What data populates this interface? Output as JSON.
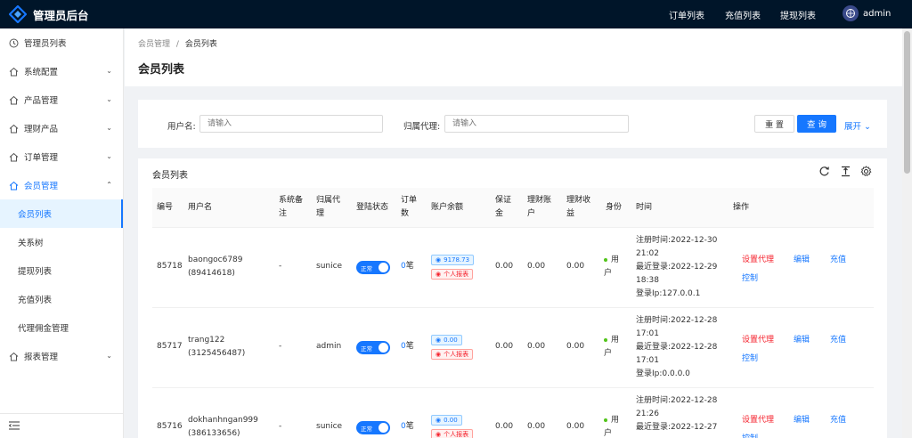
{
  "app": {
    "title": "管理员后台"
  },
  "header": {
    "nav": [
      "订单列表",
      "充值列表",
      "提现列表"
    ],
    "user": "admin"
  },
  "sidebar": {
    "items": [
      {
        "label": "管理员列表"
      },
      {
        "label": "系统配置"
      },
      {
        "label": "产品管理"
      },
      {
        "label": "理财产品"
      },
      {
        "label": "订单管理"
      },
      {
        "label": "会员管理"
      },
      {
        "label": "报表管理"
      }
    ],
    "subitems": [
      "会员列表",
      "关系树",
      "提现列表",
      "充值列表",
      "代理佣金管理"
    ],
    "active": "会员列表"
  },
  "breadcrumb": [
    "会员管理",
    "/",
    "会员列表"
  ],
  "page_title": "会员列表",
  "filter": {
    "username_label": "用户名:",
    "username_placeholder": "请输入",
    "agent_label": "归属代理:",
    "agent_placeholder": "请输入",
    "reset": "重 置",
    "query": "查 询",
    "expand": "展开"
  },
  "table": {
    "caption": "会员列表",
    "headers": [
      "编号",
      "用户名",
      "系统备注",
      "归属代理",
      "登陆状态",
      "订单数",
      "账户余额",
      "保证金",
      "理财账户",
      "理财收益",
      "身份",
      "时间",
      "操作"
    ],
    "rows": [
      {
        "id": "85718",
        "username": "baongoc6789",
        "phone": "(89414618)",
        "remark": "-",
        "agent": "sunice",
        "status": "正常",
        "orders": "0",
        "orders_unit": "笔",
        "balance": "9178.73",
        "report": "个人报表",
        "deposit": "0.00",
        "fin_account": "0.00",
        "fin_income": "0.00",
        "identity": "用户",
        "reg": "注册时间:2022-12-30 21:02",
        "last": "最近登录:2022-12-29 18:38",
        "ip": "登录Ip:127.0.0.1",
        "actions": [
          "设置代理",
          "编辑",
          "充值",
          "控制"
        ]
      },
      {
        "id": "85717",
        "username": "trang122",
        "phone": "(3125456487)",
        "remark": "-",
        "agent": "admin",
        "status": "正常",
        "orders": "0",
        "orders_unit": "笔",
        "balance": "0.00",
        "report": "个人报表",
        "deposit": "0.00",
        "fin_account": "0.00",
        "fin_income": "0.00",
        "identity": "用户",
        "reg": "注册时间:2022-12-28 17:01",
        "last": "最近登录:2022-12-28 17:01",
        "ip": "登录Ip:0.0.0.0",
        "actions": [
          "设置代理",
          "编辑",
          "充值",
          "控制"
        ]
      },
      {
        "id": "85716",
        "username": "dokhanhngan999",
        "phone": "(386133656)",
        "remark": "-",
        "agent": "sunice",
        "status": "正常",
        "orders": "0",
        "orders_unit": "笔",
        "balance": "0.00",
        "report": "个人报表",
        "deposit": "0.00",
        "fin_account": "0.00",
        "fin_income": "0.00",
        "identity": "用户",
        "reg": "注册时间:2022-12-28 21:26",
        "last": "最近登录:2022-12-27",
        "ip": "",
        "actions": [
          "设置代理",
          "编辑",
          "充值",
          "控制"
        ]
      }
    ]
  },
  "colors": {
    "primary": "#1677ff",
    "header_bg": "#001529",
    "danger": "#f5222d",
    "success": "#52c41a"
  }
}
